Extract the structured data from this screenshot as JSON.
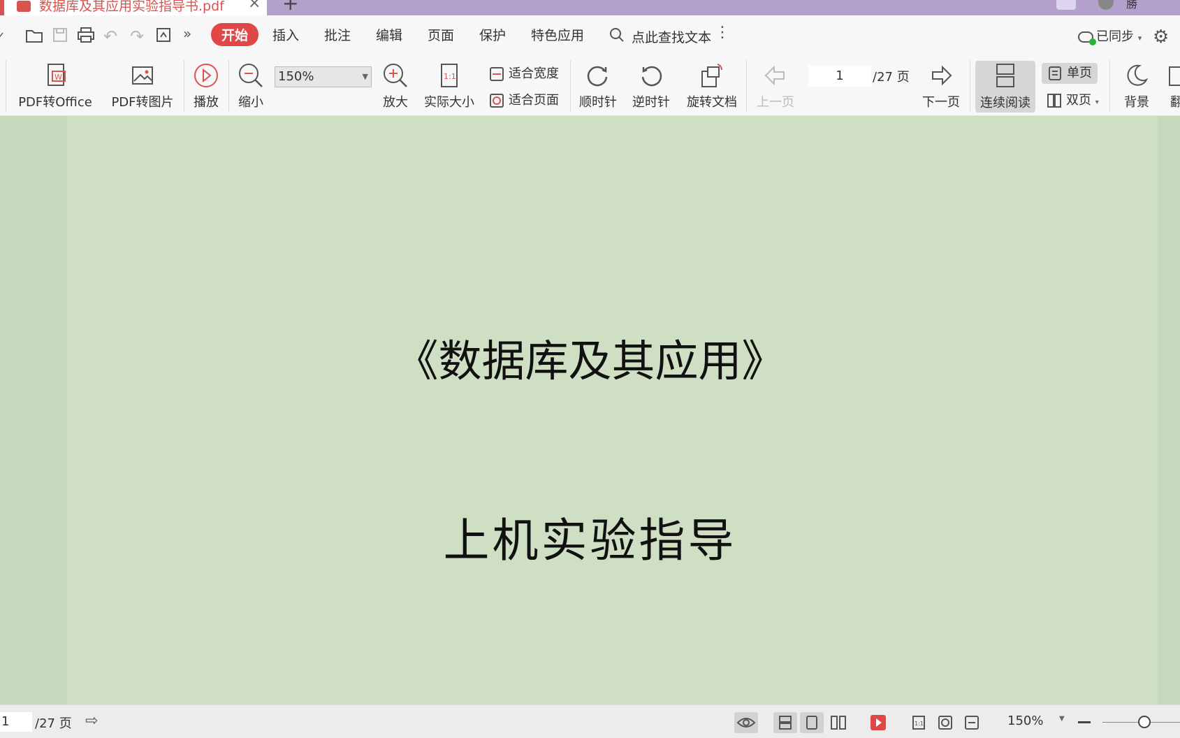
{
  "window": {
    "tab_title": "数据库及其应用实验指导书.pdf",
    "close_glyph": "×",
    "new_tab_glyph": "+",
    "user_label": "勝"
  },
  "menubar": {
    "items": [
      "开始",
      "插入",
      "批注",
      "编辑",
      "页面",
      "保护",
      "特色应用"
    ],
    "active": "开始",
    "search_placeholder": "点此查找文本",
    "more": "⋮",
    "overflow": "»",
    "sync_label": "已同步",
    "sync_dropdown": "▾"
  },
  "ribbon": {
    "pdf_to_office": "PDF转Office",
    "pdf_to_image": "PDF转图片",
    "play": "播放",
    "zoom_out": "缩小",
    "zoom_value": "150%",
    "zoom_in": "放大",
    "actual_size": "实际大小",
    "fit_width": "适合宽度",
    "fit_page": "适合页面",
    "clockwise": "顺时针",
    "counterclockwise": "逆时针",
    "rotate_doc": "旋转文档",
    "prev_page": "上一页",
    "current_page": "1",
    "total_pages": "/27 页",
    "next_page": "下一页",
    "continuous_read": "连续阅读",
    "single_page": "单页",
    "double_page": "双页",
    "background": "背景",
    "translate_partial": "翻"
  },
  "document": {
    "title": "《数据库及其应用》",
    "subtitle": "上机实验指导"
  },
  "statusbar": {
    "current_page": "1",
    "total_pages": "/27 页",
    "zoom": "150%",
    "zoom_level_fraction": 0.6
  },
  "colors": {
    "accent": "#e04848",
    "title_bar": "#b3a1cc",
    "doc_bg": "#cfdfc4"
  }
}
